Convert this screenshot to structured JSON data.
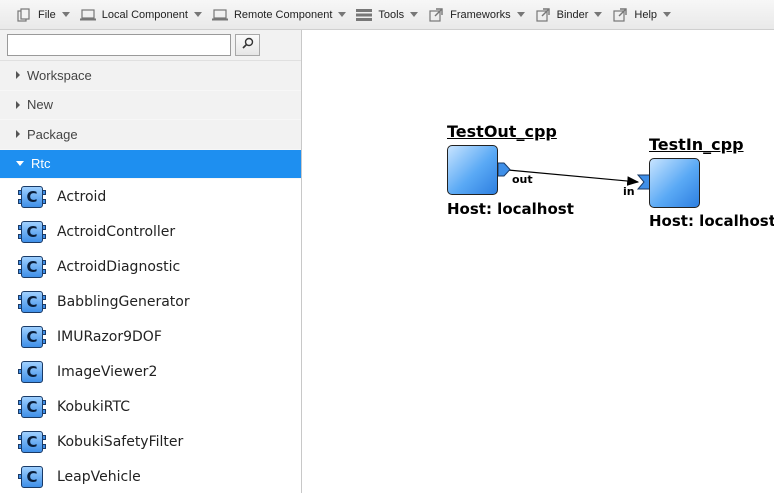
{
  "menubar": {
    "items": [
      {
        "label": "File",
        "icon": "copy-icon"
      },
      {
        "label": "Local Component",
        "icon": "laptop-icon"
      },
      {
        "label": "Remote Component",
        "icon": "laptop-icon"
      },
      {
        "label": "Tools",
        "icon": "list-icon"
      },
      {
        "label": "Frameworks",
        "icon": "external-link-icon"
      },
      {
        "label": "Binder",
        "icon": "external-link-icon"
      },
      {
        "label": "Help",
        "icon": "external-link-icon"
      }
    ]
  },
  "sidebar": {
    "search": {
      "value": "",
      "placeholder": ""
    },
    "tree": [
      {
        "label": "Workspace"
      },
      {
        "label": "New"
      },
      {
        "label": "Package"
      },
      {
        "label": "Rtc"
      }
    ],
    "rtc_items": [
      {
        "label": "Actroid"
      },
      {
        "label": "ActroidController"
      },
      {
        "label": "ActroidDiagnostic"
      },
      {
        "label": "BabblingGenerator"
      },
      {
        "label": "IMURazor9DOF"
      },
      {
        "label": "ImageViewer2"
      },
      {
        "label": "KobukiRTC"
      },
      {
        "label": "KobukiSafetyFilter"
      },
      {
        "label": "LeapVehicle"
      }
    ]
  },
  "canvas": {
    "components": [
      {
        "name": "TestOut_cpp",
        "host": "Host: localhost",
        "port_label": "out"
      },
      {
        "name": "TestIn_cpp",
        "host": "Host: localhost",
        "port_label": "in"
      }
    ]
  },
  "colors": {
    "accent": "#1e8ff0",
    "component_fill": "#5aa9f5",
    "port_fill": "#3f8fe8"
  }
}
